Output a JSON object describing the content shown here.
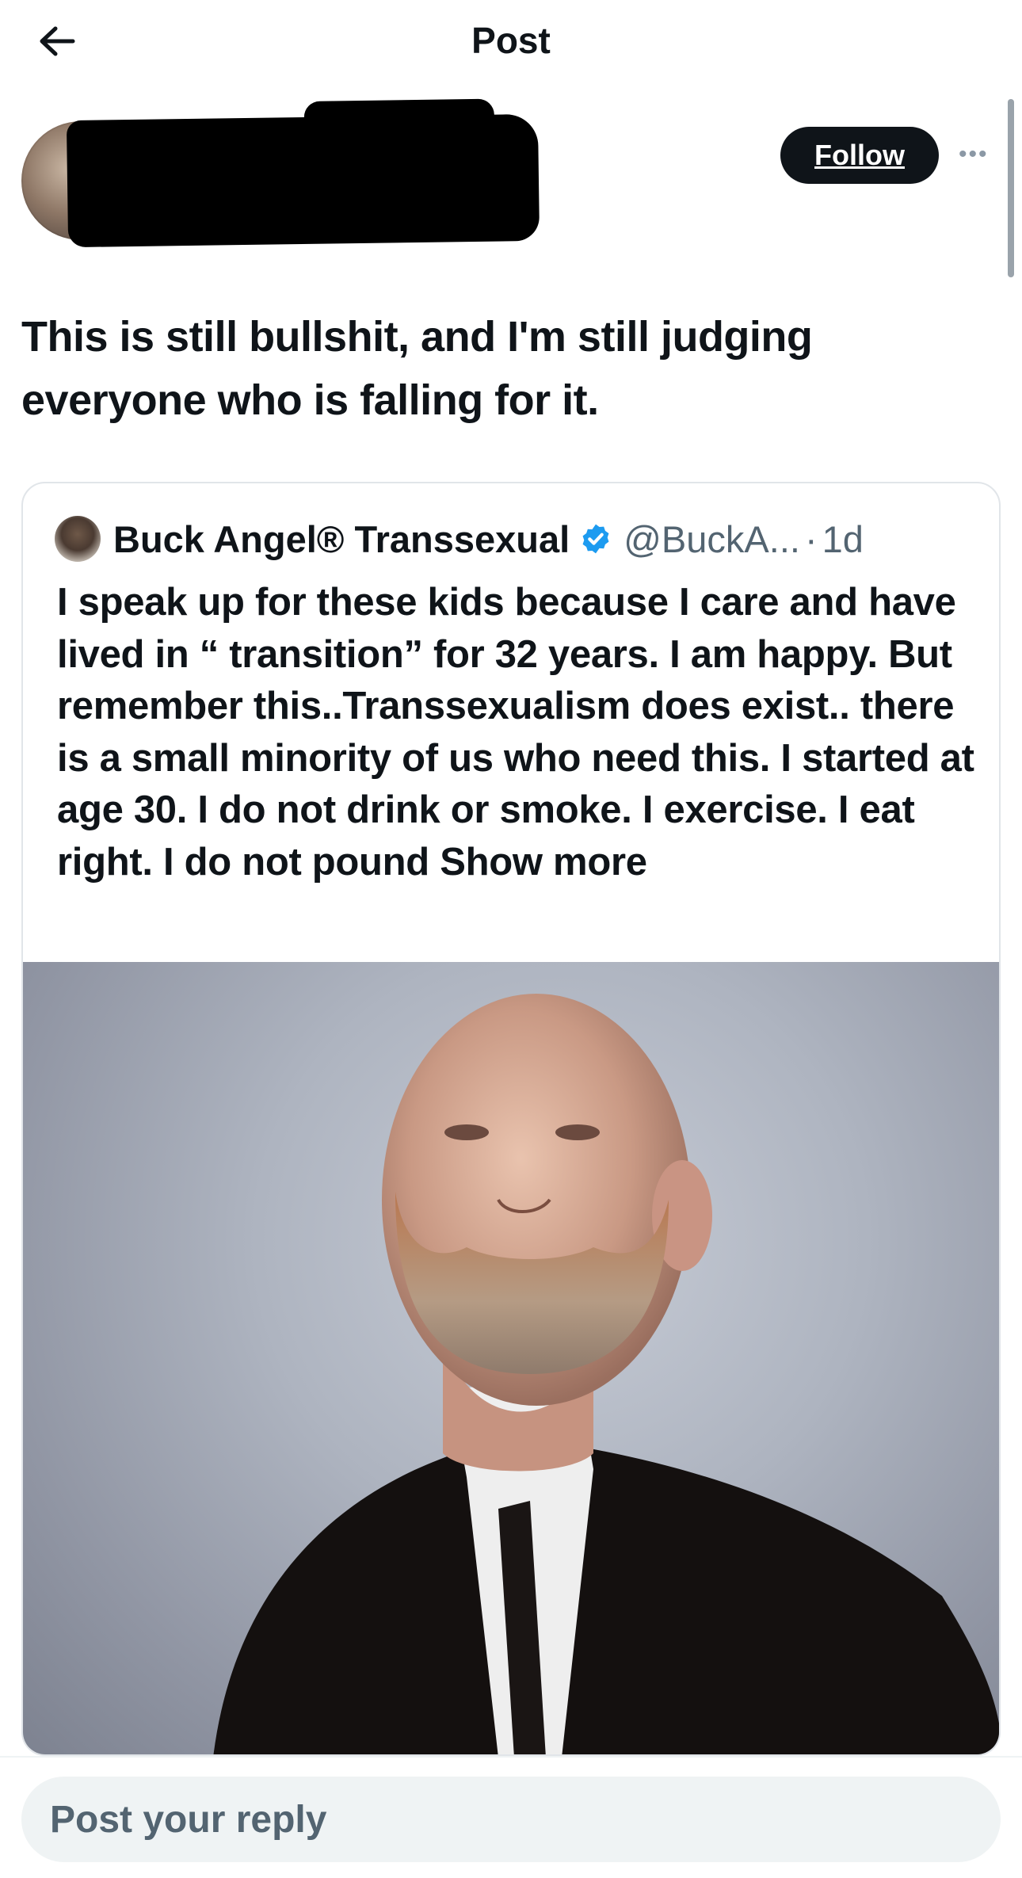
{
  "header": {
    "title": "Post"
  },
  "author": {
    "follow_label": "Follow"
  },
  "post": {
    "text": "This is still bullshit, and I'm still judging everyone who is falling for it."
  },
  "quoted": {
    "name": "Buck Angel® Transsexual",
    "handle": "@BuckA...",
    "separator": "·",
    "time": "1d",
    "text": "I speak up for these kids because I care and have lived in “ transition” for 32 years. I am happy. But remember this..Transsexualism does exist.. there is a small minority of us who need this. I started at age 30. I do not drink or smoke. I exercise. I eat right. I do not pound",
    "show_more": "Show more"
  },
  "reply": {
    "placeholder": "Post your reply"
  },
  "colors": {
    "text": "#0f1419",
    "secondary": "#536471",
    "verified": "#1d9bf0",
    "follow_bg": "#0f1419"
  }
}
